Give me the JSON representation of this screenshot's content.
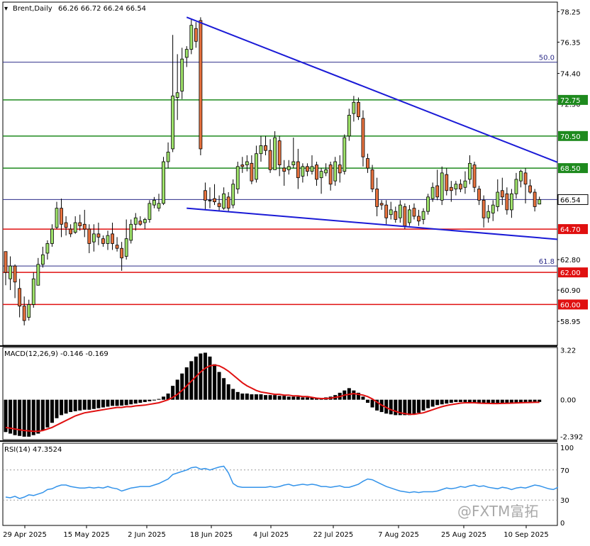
{
  "header": {
    "symbol": "Brent,Daily",
    "ohlc": "66.26 66.72 66.24 66.54",
    "macd_label": "MACD(12,26,9) -0.146 -0.169",
    "rsi_label": "RSI(14) 47.3524"
  },
  "watermark": "@FXTM富拓",
  "colors": {
    "up_candle": "#9ee26a",
    "down_candle": "#e8723e",
    "trendline": "#1a1ad6",
    "support": "#e01010",
    "resistance": "#1e8a1e",
    "fib": "#2b2b88",
    "macd_signal": "#e01010",
    "rsi_line": "#3393ea"
  },
  "chart_data": [
    {
      "type": "candlestick",
      "title": "Brent,Daily",
      "ylim": [
        57.5,
        78.8
      ],
      "y_ticks": [
        "78.25",
        "76.35",
        "74.40",
        "72.50",
        "70.50",
        "68.50",
        "66.54",
        "64.70",
        "62.80",
        "62.00",
        "60.90",
        "60.00",
        "58.95"
      ],
      "x_ticks": [
        "29 Apr 2025",
        "15 May 2025",
        "2 Jun 2025",
        "18 Jun 2025",
        "4 Jul 2025",
        "22 Jul 2025",
        "7 Aug 2025",
        "25 Aug 2025",
        "10 Sep 2025"
      ],
      "current_price": "66.54",
      "levels": [
        {
          "value": 72.75,
          "label": "72.75",
          "kind": "resistance"
        },
        {
          "value": 70.5,
          "label": "70.50",
          "kind": "resistance"
        },
        {
          "value": 68.5,
          "label": "68.50",
          "kind": "resistance"
        },
        {
          "value": 64.7,
          "label": "64.70",
          "kind": "support"
        },
        {
          "value": 62.0,
          "label": "62.00",
          "kind": "support"
        },
        {
          "value": 60.0,
          "label": "60.00",
          "kind": "support"
        }
      ],
      "fib_levels": [
        {
          "value": 75.1,
          "label": "50.0"
        },
        {
          "value": 62.4,
          "label": "61.8"
        }
      ],
      "trendlines": [
        {
          "name": "upper",
          "from": [
            39,
            77.9
          ],
          "to": [
            138,
            66.7
          ]
        },
        {
          "name": "lower",
          "from": [
            39,
            66.0
          ],
          "to": [
            138,
            63.6
          ]
        }
      ],
      "candles": [
        [
          63.3,
          63.3,
          61.2,
          62.0
        ],
        [
          61.6,
          63.0,
          60.9,
          62.4
        ],
        [
          62.4,
          62.5,
          60.4,
          61.4
        ],
        [
          61.0,
          61.6,
          59.2,
          59.9
        ],
        [
          59.9,
          60.5,
          58.7,
          59.0
        ],
        [
          59.2,
          60.3,
          59.0,
          60.0
        ],
        [
          60.0,
          62.0,
          59.8,
          61.6
        ],
        [
          61.2,
          62.9,
          61.2,
          62.5
        ],
        [
          62.5,
          63.6,
          62.3,
          63.1
        ],
        [
          63.2,
          64.0,
          62.8,
          63.8
        ],
        [
          63.8,
          65.0,
          63.6,
          64.7
        ],
        [
          64.8,
          66.4,
          64.7,
          66.0
        ],
        [
          66.0,
          66.6,
          64.2,
          65.0
        ],
        [
          65.1,
          65.5,
          64.3,
          64.8
        ],
        [
          64.7,
          65.0,
          64.2,
          64.4
        ],
        [
          64.5,
          65.5,
          64.4,
          65.1
        ],
        [
          65.1,
          65.6,
          64.6,
          64.9
        ],
        [
          65.0,
          65.9,
          64.2,
          64.7
        ],
        [
          64.7,
          65.0,
          63.2,
          63.8
        ],
        [
          63.9,
          65.0,
          63.3,
          64.4
        ],
        [
          64.4,
          65.1,
          63.7,
          64.2
        ],
        [
          64.1,
          64.3,
          63.6,
          63.8
        ],
        [
          63.8,
          64.6,
          63.4,
          64.3
        ],
        [
          64.4,
          65.1,
          63.4,
          63.8
        ],
        [
          63.7,
          64.2,
          63.3,
          63.5
        ],
        [
          63.5,
          63.9,
          62.1,
          62.9
        ],
        [
          63.0,
          65.3,
          62.8,
          64.1
        ],
        [
          64.0,
          65.3,
          63.8,
          65.0
        ],
        [
          65.0,
          65.7,
          64.6,
          65.4
        ],
        [
          65.2,
          65.5,
          64.9,
          65.0
        ],
        [
          65.1,
          65.4,
          64.7,
          65.3
        ],
        [
          65.3,
          66.5,
          65.1,
          66.3
        ],
        [
          66.2,
          66.7,
          66.0,
          66.5
        ],
        [
          66.0,
          66.9,
          65.8,
          66.3
        ],
        [
          66.3,
          69.2,
          66.2,
          68.9
        ],
        [
          68.9,
          70.1,
          68.5,
          69.5
        ],
        [
          69.7,
          76.8,
          69.5,
          73.0
        ],
        [
          72.9,
          75.6,
          71.5,
          73.2
        ],
        [
          73.3,
          76.0,
          72.8,
          75.3
        ],
        [
          75.4,
          76.1,
          74.8,
          75.9
        ],
        [
          75.9,
          77.8,
          75.6,
          77.4
        ],
        [
          77.2,
          77.6,
          76.0,
          76.4
        ],
        [
          77.7,
          77.9,
          69.3,
          69.7
        ],
        [
          67.1,
          67.6,
          65.9,
          66.5
        ],
        [
          66.5,
          67.3,
          66.0,
          66.5
        ],
        [
          66.6,
          67.5,
          66.2,
          66.4
        ],
        [
          66.3,
          66.8,
          65.8,
          66.1
        ],
        [
          66.0,
          67.3,
          65.9,
          66.9
        ],
        [
          66.7,
          67.0,
          65.8,
          66.0
        ],
        [
          66.2,
          67.8,
          66.0,
          67.5
        ],
        [
          67.2,
          68.9,
          66.9,
          68.6
        ],
        [
          68.7,
          69.2,
          68.2,
          68.6
        ],
        [
          68.7,
          69.3,
          68.3,
          68.9
        ],
        [
          68.8,
          69.3,
          67.5,
          67.7
        ],
        [
          67.8,
          69.9,
          67.6,
          69.4
        ],
        [
          69.4,
          70.5,
          68.9,
          69.9
        ],
        [
          69.9,
          70.5,
          69.3,
          69.6
        ],
        [
          69.6,
          70.3,
          68.2,
          68.4
        ],
        [
          68.4,
          70.8,
          68.4,
          70.4
        ],
        [
          70.2,
          70.5,
          68.0,
          68.7
        ],
        [
          68.5,
          69.0,
          67.4,
          68.3
        ],
        [
          68.4,
          69.0,
          68.1,
          68.6
        ],
        [
          68.7,
          70.4,
          68.5,
          68.9
        ],
        [
          68.9,
          69.7,
          67.2,
          67.9
        ],
        [
          68.0,
          68.8,
          67.6,
          68.6
        ],
        [
          68.6,
          68.8,
          68.0,
          68.3
        ],
        [
          68.3,
          69.3,
          68.1,
          68.6
        ],
        [
          68.7,
          68.9,
          67.4,
          67.8
        ],
        [
          67.9,
          68.5,
          66.9,
          68.3
        ],
        [
          68.2,
          68.8,
          68.0,
          68.4
        ],
        [
          68.7,
          68.9,
          67.1,
          67.5
        ],
        [
          67.7,
          69.2,
          67.4,
          68.9
        ],
        [
          68.7,
          69.3,
          67.6,
          68.2
        ],
        [
          68.3,
          70.6,
          68.1,
          70.4
        ],
        [
          70.5,
          72.2,
          70.2,
          71.8
        ],
        [
          71.9,
          73.0,
          71.4,
          72.6
        ],
        [
          72.6,
          72.9,
          71.5,
          71.7
        ],
        [
          71.6,
          72.1,
          68.6,
          69.2
        ],
        [
          69.1,
          69.4,
          68.2,
          68.5
        ],
        [
          68.4,
          68.7,
          67.0,
          67.2
        ],
        [
          67.2,
          67.9,
          65.5,
          66.1
        ],
        [
          66.3,
          66.5,
          65.9,
          66.2
        ],
        [
          66.2,
          66.5,
          65.0,
          65.4
        ],
        [
          65.6,
          66.4,
          65.3,
          65.9
        ],
        [
          65.8,
          66.1,
          65.1,
          65.3
        ],
        [
          65.4,
          66.5,
          65.1,
          66.2
        ],
        [
          66.1,
          66.3,
          64.7,
          64.9
        ],
        [
          65.1,
          66.2,
          64.9,
          65.9
        ],
        [
          66.0,
          66.3,
          65.3,
          65.5
        ],
        [
          65.5,
          65.9,
          64.9,
          65.2
        ],
        [
          65.3,
          66.0,
          65.0,
          65.8
        ],
        [
          65.8,
          66.9,
          65.6,
          66.7
        ],
        [
          66.6,
          67.6,
          66.4,
          67.3
        ],
        [
          67.4,
          68.4,
          66.5,
          66.7
        ],
        [
          66.5,
          68.6,
          66.2,
          68.2
        ],
        [
          68.1,
          68.5,
          66.8,
          67.1
        ],
        [
          67.3,
          67.7,
          66.4,
          67.1
        ],
        [
          67.2,
          67.7,
          66.8,
          67.5
        ],
        [
          67.5,
          67.8,
          67.0,
          67.2
        ],
        [
          67.3,
          68.3,
          66.9,
          67.7
        ],
        [
          67.8,
          69.3,
          67.5,
          68.8
        ],
        [
          68.7,
          68.9,
          67.0,
          67.3
        ],
        [
          67.2,
          67.4,
          66.2,
          66.5
        ],
        [
          66.5,
          66.8,
          64.8,
          65.4
        ],
        [
          65.4,
          66.2,
          65.1,
          65.8
        ],
        [
          65.7,
          66.5,
          65.2,
          66.2
        ],
        [
          66.1,
          67.8,
          65.8,
          67.0
        ],
        [
          67.1,
          67.9,
          66.2,
          66.7
        ],
        [
          66.9,
          67.3,
          65.6,
          65.9
        ],
        [
          65.9,
          67.2,
          65.4,
          66.9
        ],
        [
          66.9,
          68.2,
          66.6,
          67.8
        ],
        [
          67.7,
          68.4,
          67.3,
          68.3
        ],
        [
          68.2,
          68.5,
          66.3,
          67.5
        ],
        [
          67.4,
          67.8,
          66.9,
          67.0
        ],
        [
          67.0,
          67.2,
          65.8,
          66.1
        ],
        [
          66.26,
          66.72,
          66.24,
          66.54
        ]
      ]
    },
    {
      "type": "bar",
      "title": "MACD(12,26,9)",
      "values_label": "-0.146 -0.169",
      "ylim": [
        -2.5,
        3.3
      ],
      "y_ticks": [
        "3.22",
        "0.00",
        "-2.392"
      ],
      "histogram": [
        -2.1,
        -2.2,
        -2.3,
        -2.35,
        -2.4,
        -2.4,
        -2.3,
        -2.2,
        -2.0,
        -1.8,
        -1.5,
        -1.2,
        -1.0,
        -0.9,
        -0.8,
        -0.75,
        -0.7,
        -0.65,
        -0.65,
        -0.6,
        -0.55,
        -0.5,
        -0.45,
        -0.4,
        -0.4,
        -0.38,
        -0.35,
        -0.3,
        -0.25,
        -0.2,
        -0.15,
        -0.1,
        -0.05,
        0.05,
        0.2,
        0.4,
        0.9,
        1.3,
        1.7,
        2.1,
        2.5,
        2.8,
        3.0,
        3.05,
        2.8,
        2.3,
        1.8,
        1.4,
        1.0,
        0.7,
        0.5,
        0.4,
        0.4,
        0.35,
        0.35,
        0.35,
        0.3,
        0.3,
        0.3,
        0.25,
        0.25,
        0.2,
        0.2,
        0.2,
        0.15,
        0.15,
        0.15,
        0.1,
        0.1,
        0.15,
        0.2,
        0.3,
        0.45,
        0.6,
        0.75,
        0.6,
        0.45,
        0.2,
        -0.2,
        -0.5,
        -0.7,
        -0.8,
        -0.9,
        -0.95,
        -1.0,
        -1.0,
        -1.0,
        -1.0,
        -0.95,
        -0.85,
        -0.7,
        -0.55,
        -0.45,
        -0.35,
        -0.3,
        -0.25,
        -0.2,
        -0.15,
        -0.15,
        -0.15,
        -0.2,
        -0.2,
        -0.25,
        -0.25,
        -0.25,
        -0.25,
        -0.25,
        -0.2,
        -0.2,
        -0.2,
        -0.2,
        -0.2,
        -0.2,
        -0.15,
        -0.15,
        -0.146
      ],
      "signal": [
        -1.8,
        -1.85,
        -1.9,
        -1.95,
        -2.0,
        -2.02,
        -2.05,
        -2.05,
        -2.0,
        -1.9,
        -1.8,
        -1.65,
        -1.5,
        -1.35,
        -1.2,
        -1.05,
        -0.95,
        -0.85,
        -0.8,
        -0.75,
        -0.7,
        -0.65,
        -0.6,
        -0.55,
        -0.5,
        -0.5,
        -0.45,
        -0.45,
        -0.4,
        -0.38,
        -0.35,
        -0.3,
        -0.25,
        -0.2,
        -0.1,
        0.0,
        0.15,
        0.35,
        0.6,
        0.9,
        1.2,
        1.5,
        1.8,
        2.05,
        2.2,
        2.25,
        2.2,
        2.05,
        1.85,
        1.6,
        1.35,
        1.1,
        0.9,
        0.75,
        0.6,
        0.5,
        0.45,
        0.4,
        0.35,
        0.35,
        0.3,
        0.3,
        0.25,
        0.25,
        0.2,
        0.2,
        0.15,
        0.1,
        0.08,
        0.08,
        0.1,
        0.15,
        0.2,
        0.3,
        0.35,
        0.4,
        0.35,
        0.3,
        0.2,
        0.05,
        -0.15,
        -0.35,
        -0.5,
        -0.65,
        -0.75,
        -0.85,
        -0.9,
        -0.95,
        -0.95,
        -0.9,
        -0.85,
        -0.75,
        -0.65,
        -0.55,
        -0.45,
        -0.38,
        -0.32,
        -0.27,
        -0.22,
        -0.2,
        -0.2,
        -0.2,
        -0.22,
        -0.23,
        -0.24,
        -0.25,
        -0.25,
        -0.24,
        -0.23,
        -0.22,
        -0.21,
        -0.2,
        -0.19,
        -0.18,
        -0.17,
        -0.169
      ]
    },
    {
      "type": "line",
      "title": "RSI(14)",
      "values_label": "47.3524",
      "ylim": [
        0,
        100
      ],
      "y_ticks": [
        "100",
        "70",
        "30",
        "0"
      ],
      "levels": [
        70,
        30
      ],
      "values": [
        34,
        33,
        35,
        32,
        34,
        37,
        36,
        38,
        40,
        44,
        45,
        48,
        50,
        50,
        48,
        47,
        46,
        46,
        47,
        46,
        47,
        46,
        48,
        46,
        45,
        42,
        44,
        46,
        47,
        48,
        48,
        48,
        50,
        52,
        55,
        58,
        64,
        66,
        68,
        70,
        73,
        74,
        71,
        72,
        70,
        72,
        74,
        75,
        66,
        52,
        48,
        47,
        47,
        47,
        47,
        47,
        47,
        48,
        47,
        48,
        50,
        51,
        49,
        50,
        51,
        50,
        51,
        50,
        48,
        48,
        47,
        48,
        49,
        47,
        47,
        49,
        51,
        55,
        58,
        57,
        54,
        51,
        48,
        46,
        44,
        42,
        41,
        40,
        41,
        40,
        41,
        41,
        41,
        42,
        44,
        46,
        45,
        46,
        48,
        47,
        49,
        50,
        48,
        49,
        47,
        46,
        45,
        47,
        46,
        44,
        46,
        47,
        46,
        48,
        50,
        49,
        47,
        45,
        44,
        47
      ]
    }
  ]
}
